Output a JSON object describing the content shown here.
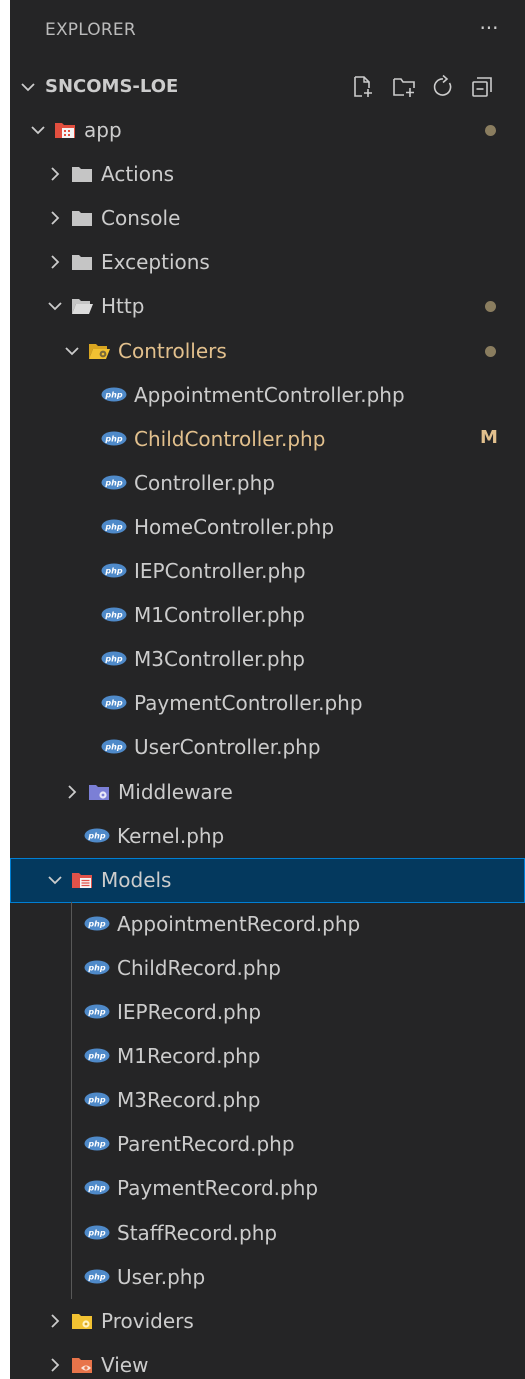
{
  "explorer": {
    "header_title": "EXPLORER",
    "more_label": "···",
    "section_title": "SNCOMS-LOE",
    "actions": [
      {
        "name": "new-file-icon"
      },
      {
        "name": "new-folder-icon"
      },
      {
        "name": "refresh-icon"
      },
      {
        "name": "collapse-all-icon"
      }
    ]
  },
  "colors": {
    "background": "#252526",
    "text": "#cccccc",
    "modified": "#e2c08d",
    "selection": "#04395e",
    "selection_border": "#007fd4",
    "php_icon": "#4f8ac9"
  },
  "tree": [
    {
      "label": "app",
      "type": "folder",
      "expanded": true,
      "icon": "app-folder-icon",
      "dot": true,
      "depth": 1
    },
    {
      "label": "Actions",
      "type": "folder",
      "expanded": false,
      "icon": "folder-icon",
      "depth": 2
    },
    {
      "label": "Console",
      "type": "folder",
      "expanded": false,
      "icon": "folder-icon",
      "depth": 2
    },
    {
      "label": "Exceptions",
      "type": "folder",
      "expanded": false,
      "icon": "folder-icon",
      "depth": 2
    },
    {
      "label": "Http",
      "type": "folder",
      "expanded": true,
      "icon": "folder-open-icon",
      "dot": true,
      "depth": 2
    },
    {
      "label": "Controllers",
      "type": "folder",
      "expanded": true,
      "icon": "controllers-folder-icon",
      "dot": true,
      "modified": true,
      "depth": 3
    },
    {
      "label": "AppointmentController.php",
      "type": "file",
      "icon": "php-icon",
      "depth": 4
    },
    {
      "label": "ChildController.php",
      "type": "file",
      "icon": "php-icon",
      "badge": "M",
      "modified": true,
      "depth": 4
    },
    {
      "label": "Controller.php",
      "type": "file",
      "icon": "php-icon",
      "depth": 4
    },
    {
      "label": "HomeController.php",
      "type": "file",
      "icon": "php-icon",
      "depth": 4
    },
    {
      "label": "IEPController.php",
      "type": "file",
      "icon": "php-icon",
      "depth": 4
    },
    {
      "label": "M1Controller.php",
      "type": "file",
      "icon": "php-icon",
      "depth": 4
    },
    {
      "label": "M3Controller.php",
      "type": "file",
      "icon": "php-icon",
      "depth": 4
    },
    {
      "label": "PaymentController.php",
      "type": "file",
      "icon": "php-icon",
      "depth": 4
    },
    {
      "label": "UserController.php",
      "type": "file",
      "icon": "php-icon",
      "depth": 4
    },
    {
      "label": "Middleware",
      "type": "folder",
      "expanded": false,
      "icon": "middleware-folder-icon",
      "depth": 3
    },
    {
      "label": "Kernel.php",
      "type": "file",
      "icon": "php-icon",
      "depth": 3
    },
    {
      "label": "Models",
      "type": "folder",
      "expanded": true,
      "icon": "models-folder-icon",
      "selected": true,
      "depth": 2
    },
    {
      "label": "AppointmentRecord.php",
      "type": "file",
      "icon": "php-icon",
      "depth": 3
    },
    {
      "label": "ChildRecord.php",
      "type": "file",
      "icon": "php-icon",
      "depth": 3
    },
    {
      "label": "IEPRecord.php",
      "type": "file",
      "icon": "php-icon",
      "depth": 3
    },
    {
      "label": "M1Record.php",
      "type": "file",
      "icon": "php-icon",
      "depth": 3
    },
    {
      "label": "M3Record.php",
      "type": "file",
      "icon": "php-icon",
      "depth": 3
    },
    {
      "label": "ParentRecord.php",
      "type": "file",
      "icon": "php-icon",
      "depth": 3
    },
    {
      "label": "PaymentRecord.php",
      "type": "file",
      "icon": "php-icon",
      "depth": 3
    },
    {
      "label": "StaffRecord.php",
      "type": "file",
      "icon": "php-icon",
      "depth": 3
    },
    {
      "label": "User.php",
      "type": "file",
      "icon": "php-icon",
      "depth": 3
    },
    {
      "label": "Providers",
      "type": "folder",
      "expanded": false,
      "icon": "providers-folder-icon",
      "depth": 2
    },
    {
      "label": "View",
      "type": "folder",
      "expanded": false,
      "icon": "view-folder-icon",
      "depth": 2
    }
  ]
}
